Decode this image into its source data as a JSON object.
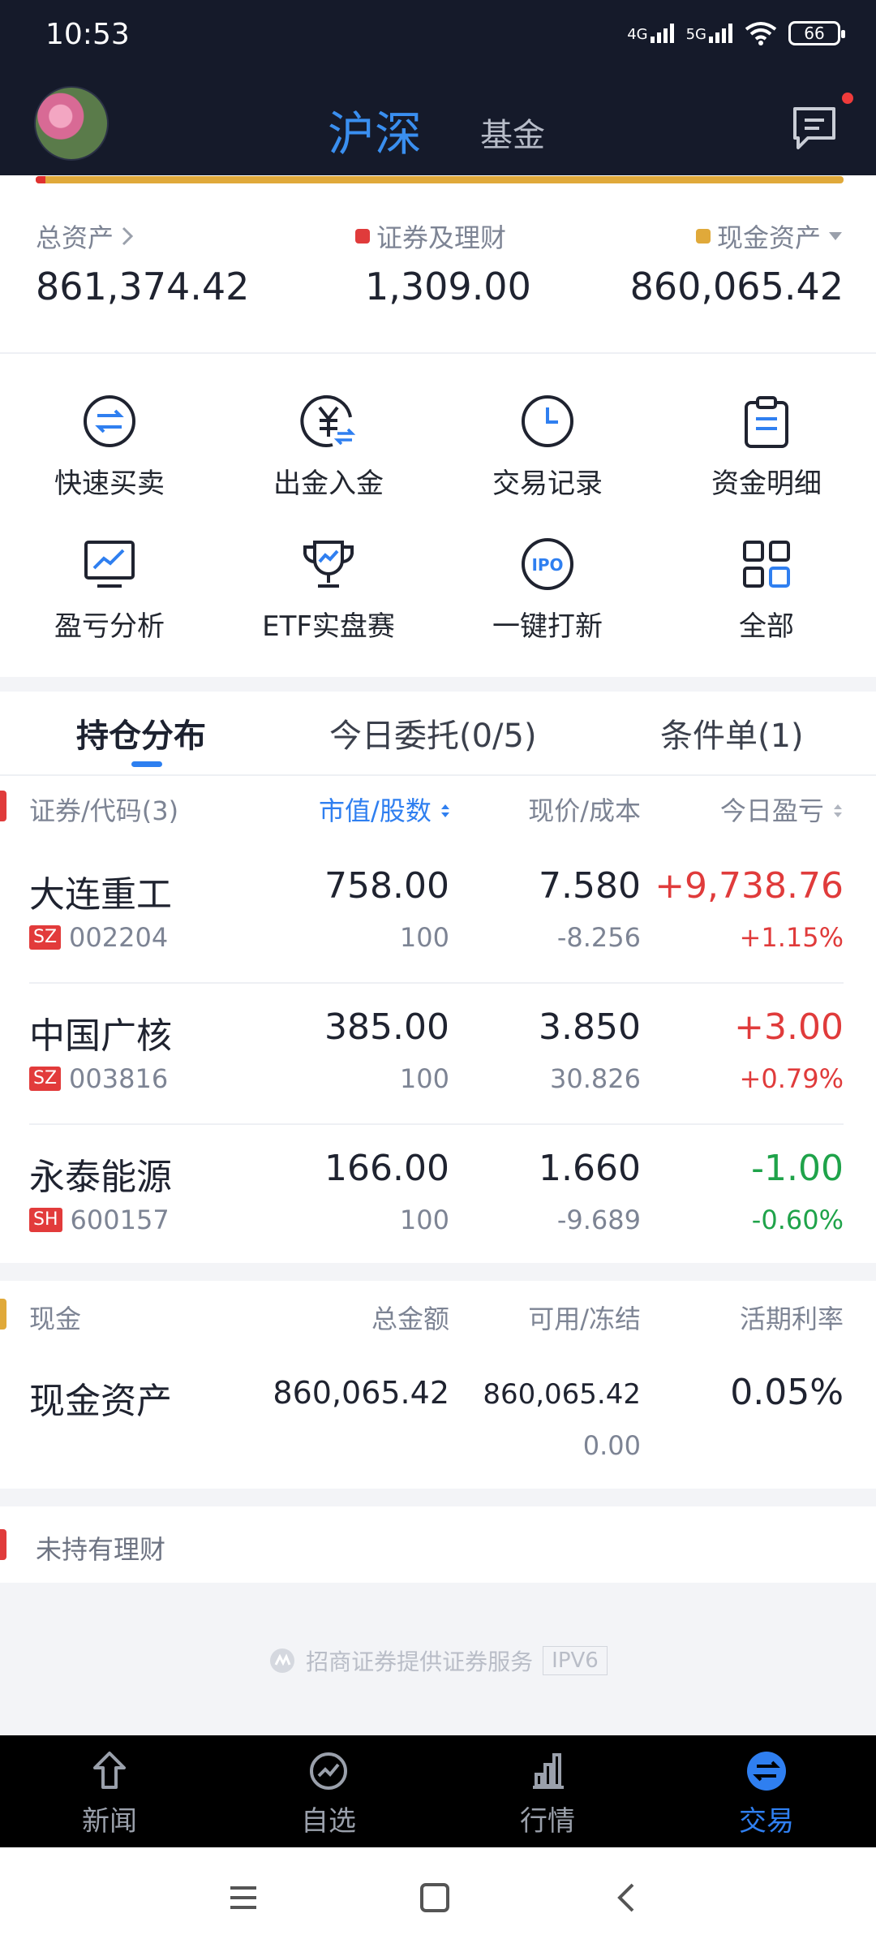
{
  "status_bar": {
    "time": "10:53",
    "network1": "4G",
    "network2": "5G",
    "battery": "66"
  },
  "header": {
    "tab_active": "沪深",
    "tab_fund": "基金"
  },
  "assets": {
    "total_label": "总资产",
    "total_value": "861,374.42",
    "securities_label": "证券及理财",
    "securities_value": "1,309.00",
    "cash_label": "现金资产",
    "cash_value": "860,065.42"
  },
  "quick_actions": [
    {
      "label": "快速买卖",
      "icon": "swap-icon"
    },
    {
      "label": "出金入金",
      "icon": "yuan-transfer-icon"
    },
    {
      "label": "交易记录",
      "icon": "clock-icon"
    },
    {
      "label": "资金明细",
      "icon": "clipboard-icon"
    },
    {
      "label": "盈亏分析",
      "icon": "chart-monitor-icon"
    },
    {
      "label": "ETF实盘赛",
      "icon": "trophy-icon"
    },
    {
      "label": "一键打新",
      "icon": "ipo-icon"
    },
    {
      "label": "全部",
      "icon": "grid-icon"
    }
  ],
  "holding_tabs": [
    "持仓分布",
    "今日委托(0/5)",
    "条件单(1)"
  ],
  "holdings_header": {
    "security": "证券/代码(3)",
    "market_value": "市值/股数",
    "price": "现价/成本",
    "today_pl": "今日盈亏"
  },
  "holdings": [
    {
      "name": "大连重工",
      "exchange": "SZ",
      "code": "002204",
      "value": "758.00",
      "shares": "100",
      "price": "7.580",
      "cost": "-8.256",
      "pl": "+9,738.76",
      "pl_pct": "+1.15%"
    },
    {
      "name": "中国广核",
      "exchange": "SZ",
      "code": "003816",
      "value": "385.00",
      "shares": "100",
      "price": "3.850",
      "cost": "30.826",
      "pl": "+3.00",
      "pl_pct": "+0.79%"
    },
    {
      "name": "永泰能源",
      "exchange": "SH",
      "code": "600157",
      "value": "166.00",
      "shares": "100",
      "price": "1.660",
      "cost": "-9.689",
      "pl": "-1.00",
      "pl_pct": "-0.60%"
    }
  ],
  "cash_section": {
    "title": "现金",
    "total_head": "总金额",
    "avail_head": "可用/冻结",
    "rate_head": "活期利率",
    "row_name": "现金资产",
    "total": "860,065.42",
    "available": "860,065.42",
    "frozen": "0.00",
    "rate": "0.05%"
  },
  "wealth_section": {
    "title": "未持有理财"
  },
  "footer": {
    "brand": "招商证券提供证券服务",
    "badge": "IPV6"
  },
  "bottom_nav": [
    {
      "label": "新闻",
      "icon": "news-icon"
    },
    {
      "label": "自选",
      "icon": "watchlist-icon"
    },
    {
      "label": "行情",
      "icon": "market-icon"
    },
    {
      "label": "交易",
      "icon": "trade-icon"
    }
  ],
  "colors": {
    "accent": "#2f7ff0",
    "rise": "#e03b3b",
    "fall": "#1fa34a",
    "cash": "#e0a93a"
  }
}
